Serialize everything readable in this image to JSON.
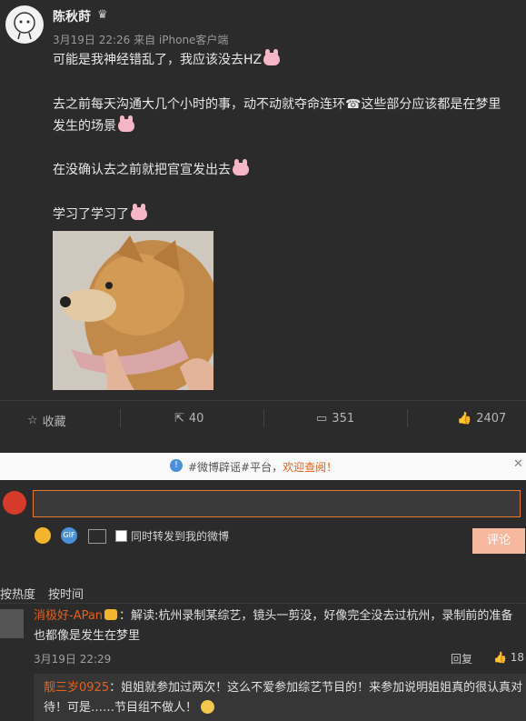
{
  "post": {
    "author": "陈秋莳",
    "meta": "3月19日 22:26 来自 iPhone客户端",
    "paragraphs": [
      "可能是我神经错乱了，我应该没去HZ",
      "去之前每天沟通大几个小时的事，动不动就夺命连环☎这些部分应该都是在梦里",
      "发生的场景",
      "在没确认去之前就把官宣发出去",
      "学习了学习了"
    ]
  },
  "actions": {
    "favorite": "收藏",
    "forward": "40",
    "comments": "351",
    "likes": "2407"
  },
  "notice": {
    "text_pre": "#微博辟谣#平台，",
    "text_link": "欢迎查阅！"
  },
  "composer": {
    "sync_label": "同时转发到我的微博",
    "submit": "评论"
  },
  "sort": {
    "hot": "按热度",
    "time": "按时间"
  },
  "comment": {
    "user": "消极好-APan",
    "text": "：解读:杭州录制某综艺，镜头一剪没，好像完全没去过杭州，录制前的准备也都像是发生在梦里",
    "time": "3月19日 22:29",
    "reply": "回复",
    "likes": "18"
  },
  "subcomment": {
    "user": "靓三岁0925",
    "text": "：姐姐就参加过两次！这么不爱参加综艺节目的！来参加说明姐姐真的很认真对待！可是……节目组不做人！"
  }
}
